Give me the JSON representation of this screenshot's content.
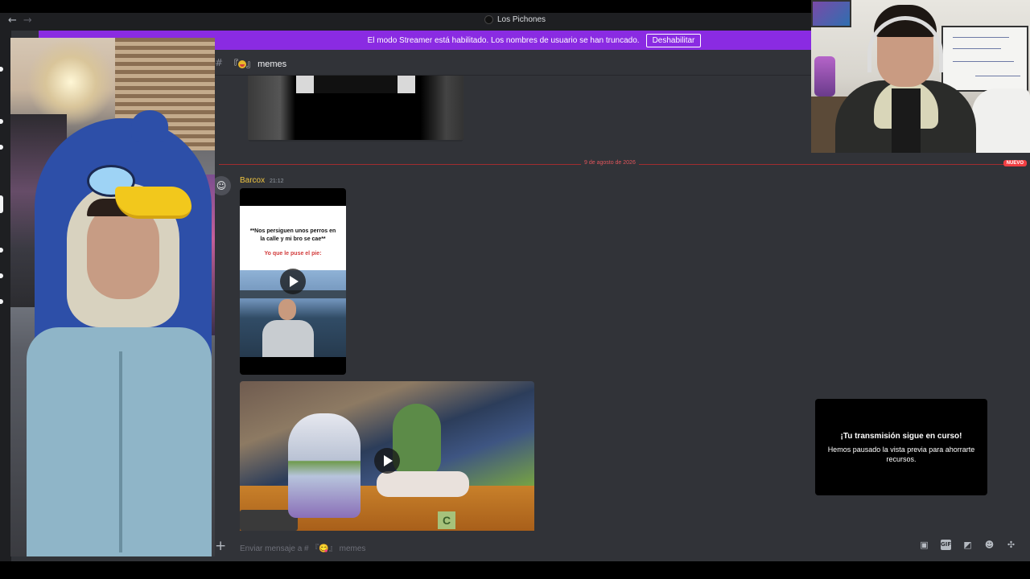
{
  "window": {
    "server_name": "Los Pichones",
    "back_arrow": "←",
    "forward_arrow": "→"
  },
  "banner": {
    "text": "El modo Streamer está habilitado. Los nombres de usuario se han truncado.",
    "button": "Deshabilitar"
  },
  "channel": {
    "hash": "#",
    "bracket_open": "『",
    "bracket_close": "』",
    "name": "memes"
  },
  "divider": {
    "date": "9 de agosto de 2026",
    "new_badge": "NUEVO"
  },
  "message": {
    "author": "Barcox",
    "timestamp": "21:12",
    "video1_caption": "**Nos persiguen unos perros en la calle y mi bro se cae**",
    "video1_subcaption": "Yo que le puse el pie:",
    "block_letter": "C"
  },
  "stream_card": {
    "title": "¡Tu transmisión sigue en curso!",
    "body": "Hemos pausado la vista previa para ahorrarte recursos."
  },
  "composer": {
    "plus": "+",
    "placeholder": "Enviar mensaje a # 『😋』 memes",
    "icons": [
      "gift-icon",
      "gif-icon",
      "sticker-icon",
      "emoji-icon",
      "apps-icon"
    ],
    "gif_label": "GIF"
  },
  "colors": {
    "accent_banner": "#8a2be2",
    "new_divider": "#f23f43",
    "author": "#f0c540",
    "background": "#313338"
  }
}
